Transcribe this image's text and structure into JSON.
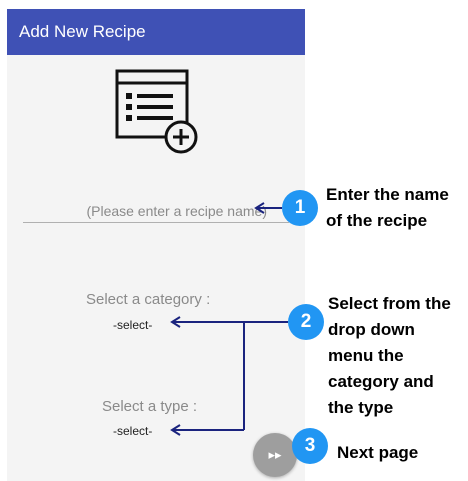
{
  "app_bar": {
    "title": "Add New Recipe"
  },
  "form": {
    "recipe_name_placeholder": "(Please enter a recipe name)",
    "category_label": "Select a category :",
    "category_value": "-select-",
    "type_label": "Select a type :",
    "type_value": "-select-"
  },
  "fab": {
    "icon": "fast-forward-icon",
    "glyph": "▸▸"
  },
  "annotations": [
    {
      "number": "1",
      "lines": [
        "Enter the name",
        "of the recipe"
      ]
    },
    {
      "number": "2",
      "lines": [
        "Select from the",
        "drop down",
        "menu the",
        "category and",
        "the type"
      ]
    },
    {
      "number": "3",
      "lines": [
        "Next page"
      ]
    }
  ],
  "colors": {
    "app_bar": "#3f51b5",
    "badge": "#2196f3",
    "arrow": "#1a237e",
    "fab": "#9e9e9e"
  }
}
